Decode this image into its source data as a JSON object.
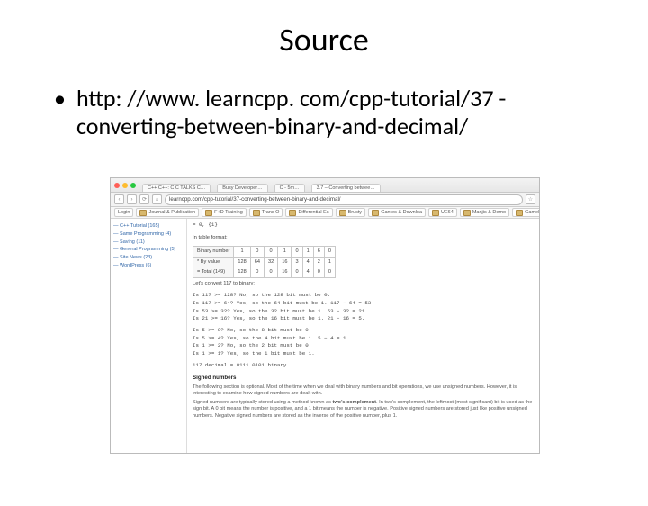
{
  "title": "Source",
  "bullet_text": "http: //www. learncpp. com/cpp-tutorial/37 -converting-between-binary-and-decimal/",
  "browser": {
    "traffic_lights": [
      "#ff5f57",
      "#febc2e",
      "#28c840"
    ],
    "tabs": [
      "C++  C++: C  C TALKS  C…",
      "Busy Developer…",
      "C - 5m…",
      "3.7 – Converting betwee…"
    ],
    "url": "learncpp.com/cpp-tutorial/37-converting-between-binary-and-decimal/",
    "bookmarks": [
      "Login",
      "Journal & Publication",
      "F+D Training",
      "Trans O",
      "Differential Es",
      "Brusty",
      "Gantes & Downloa",
      "UE64",
      "Manjis & Demo",
      "GameBos"
    ]
  },
  "sidebar": {
    "items": [
      "— C++ Tutorial (165)",
      "— Same Programming (4)",
      "— Saving (11)",
      "— General Programming (5)",
      "— Site News (23)",
      "— WordPress (6)"
    ]
  },
  "page": {
    "intro1": "= 0, {1}",
    "intro2": "In table format:",
    "table": {
      "rows": [
        {
          "label": "Binary number",
          "cells": [
            "1",
            "0",
            "0",
            "1",
            "0",
            "1",
            "6",
            "0"
          ]
        },
        {
          "label": "* By value",
          "cells": [
            "128",
            "64",
            "32",
            "16",
            "3",
            "4",
            "2",
            "1"
          ]
        },
        {
          "label": "= Total (149)",
          "cells": [
            "128",
            "0",
            "0",
            "16",
            "0",
            "4",
            "0",
            "0"
          ]
        }
      ]
    },
    "lets": "Let's convert 117 to binary:",
    "steps": [
      "Is 117 >= 128? No, so the 128 bit must be 0.",
      "Is 117 >= 64? Yes, so the 64 bit must be 1. 117 − 64 = 53",
      "Is 53 >= 32? Yes, so the 32 bit must be 1. 53 − 32 = 21.",
      "Is 21 >= 16? Yes, so the 16 bit must be 1. 21 − 16 = 5.",
      "",
      "Is 5 >= 8? No, so the 8 bit must be 0.",
      "Is 5 >= 4? Yes, so the 4 bit must be 1. 5 − 4 = 1.",
      "Is 1 >= 2? No, so the 2 bit must be 0.",
      "Is 1 >= 1? Yes, so the 1 bit must be 1."
    ],
    "result": "117 decimal = 0111 0101 binary",
    "signed_hdr": "Signed numbers",
    "signed_p1": "The following section is optional. Most of the time when we deal with binary numbers and bit operations, we use unsigned numbers. However, it is interesting to examine how signed numbers are dealt with.",
    "signed_p2_a": "Signed numbers are typically stored using a method known as ",
    "signed_p2_b": "two's complement",
    "signed_p2_c": ". In two's complement, the leftmost (most significant) bit is used as the sign bit. A 0 bit means the number is positive, and a 1 bit means the number is negative. Positive signed numbers are stored just like positive unsigned numbers. Negative signed numbers are stored as the inverse of the positive number, plus 1."
  }
}
